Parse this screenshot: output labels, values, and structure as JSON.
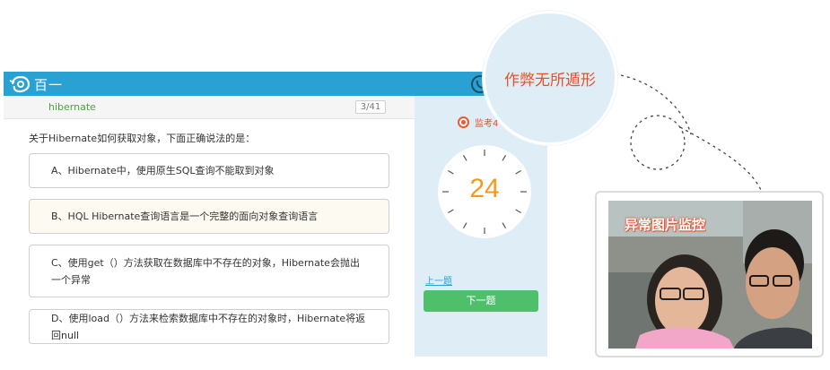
{
  "app": {
    "brand": "百一"
  },
  "exam": {
    "course": "hibernate",
    "progress": "3/41",
    "question": "关于Hibernate如何获取对象，下面正确说法的是：",
    "options": [
      "A、Hibernate中，使用原生SQL查询不能取到对象",
      "B、HQL Hibernate查询语言是一个完整的面向对象查询语言",
      "C、使用get（）方法获取在数据库中不存在的对象，Hibernate会抛出一个异常",
      "D、使用load（）方法来检索数据库中不存在的对象时，Hibernate将返回null"
    ],
    "highlighted_option": 1
  },
  "side": {
    "monitor_label": "监考4",
    "timer_value": "24",
    "prev_label": "上一题",
    "next_label": "下一题"
  },
  "overlay": {
    "bubble_text": "作弊无所遁形",
    "cam_label": "异常图片监控"
  },
  "colors": {
    "topbar": "#2aa1d3",
    "side_panel": "#dfeef6",
    "course": "#49a43d",
    "timer": "#f59a1c",
    "next_button": "#4fbf6c",
    "accent_red": "#e8512a"
  },
  "icons": [
    "logo-icon",
    "phone-icon",
    "record-icon",
    "timer-dial-icon"
  ]
}
